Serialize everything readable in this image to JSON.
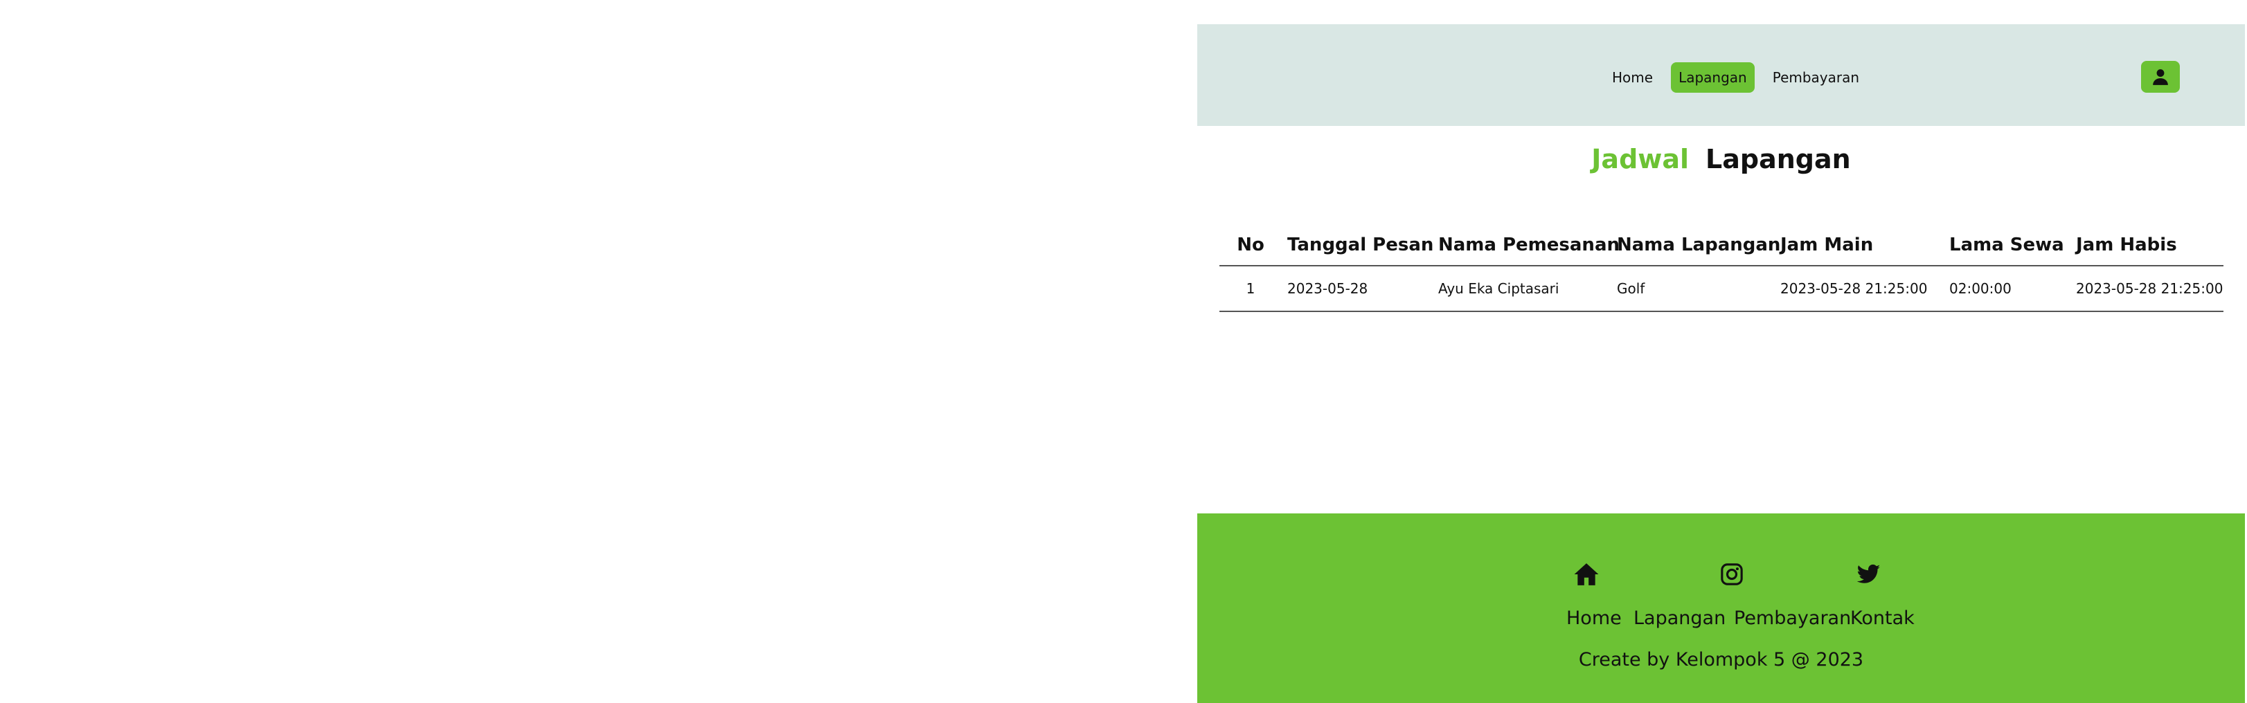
{
  "nav": {
    "links": [
      {
        "label": "Home"
      },
      {
        "label": "Lapangan"
      },
      {
        "label": "Pembayaran"
      }
    ],
    "active_index": 1,
    "user_icon": "user-icon"
  },
  "title": {
    "accent": "Jadwal",
    "main": "Lapangan"
  },
  "table": {
    "headers": [
      "No",
      "Tanggal Pesan",
      "Nama Pemesanan",
      "Nama Lapangan",
      "Jam Main",
      "Lama Sewa",
      "Jam Habis"
    ],
    "rows": [
      [
        "1",
        "2023-05-28",
        "Ayu Eka Ciptasari",
        "Golf",
        "2023-05-28 21:25:00",
        "02:00:00",
        "2023-05-28 21:25:00"
      ]
    ]
  },
  "footer": {
    "icons": [
      "home-icon",
      "instagram-icon",
      "twitter-icon"
    ],
    "links": [
      "Home",
      "Lapangan",
      "Pembayaran",
      "Kontak"
    ],
    "credit": "Create by Kelompok 5 @ 2023"
  },
  "colors": {
    "accent": "#6cc234",
    "navbar_bg": "#d9e7e4"
  }
}
